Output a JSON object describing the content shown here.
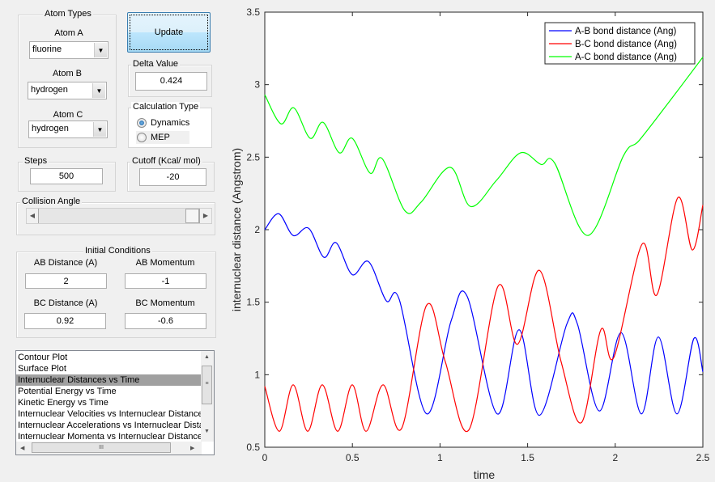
{
  "atom_types": {
    "title": "Atom Types",
    "atom_a_label": "Atom A",
    "atom_a": "fluorine",
    "atom_b_label": "Atom B",
    "atom_b": "hydrogen",
    "atom_c_label": "Atom C",
    "atom_c": "hydrogen"
  },
  "update_label": "Update",
  "delta": {
    "title": "Delta Value",
    "value": "0.424"
  },
  "calc_type": {
    "title": "Calculation Type",
    "options": [
      "Dynamics",
      "MEP"
    ],
    "selected": "Dynamics"
  },
  "steps": {
    "title": "Steps",
    "value": "500"
  },
  "cutoff": {
    "title": "Cutoff (Kcal/ mol)",
    "value": "-20"
  },
  "collision": {
    "title": "Collision Angle",
    "slider_fraction": 1.0
  },
  "initial": {
    "title": "Initial Conditions",
    "ab_dist_label": "AB Distance (A)",
    "ab_dist": "2",
    "ab_mom_label": "AB Momentum",
    "ab_mom": "-1",
    "bc_dist_label": "BC Distance (A)",
    "bc_dist": "0.92",
    "bc_mom_label": "BC Momentum",
    "bc_mom": "-0.6"
  },
  "plot_list": {
    "items": [
      "Contour Plot",
      "Surface Plot",
      "Internuclear Distances vs Time",
      "Potential Energy vs Time",
      "Kinetic Energy vs Time",
      "Internuclear Velocities vs Internuclear Distance",
      "Internuclear Accelerations vs Internuclear Distance",
      "Internuclear Momenta vs Internuclear Distance"
    ],
    "selected_index": 2
  },
  "chart_data": {
    "type": "line",
    "xlabel": "time",
    "ylabel": "internuclear distance (Angstrom)",
    "xlim": [
      0,
      2.5
    ],
    "ylim": [
      0.5,
      3.5
    ],
    "xticks": [
      "0",
      "0.5",
      "1",
      "1.5",
      "2",
      "2.5"
    ],
    "yticks": [
      "0.5",
      "1",
      "1.5",
      "2",
      "2.5",
      "3",
      "3.5"
    ],
    "legend_placement": "top-right",
    "grid": false,
    "series": [
      {
        "name": "A-B bond distance (Ang)",
        "color": "#0000ff",
        "points": [
          [
            0,
            2.0
          ],
          [
            0.079,
            2.11
          ],
          [
            0.162,
            1.96
          ],
          [
            0.25,
            2.01
          ],
          [
            0.337,
            1.81
          ],
          [
            0.407,
            1.91
          ],
          [
            0.499,
            1.69
          ],
          [
            0.592,
            1.78
          ],
          [
            0.693,
            1.51
          ],
          [
            0.767,
            1.52
          ],
          [
            0.924,
            0.73
          ],
          [
            1.063,
            1.37
          ],
          [
            1.155,
            1.54
          ],
          [
            1.326,
            0.73
          ],
          [
            1.451,
            1.31
          ],
          [
            1.567,
            0.72
          ],
          [
            1.724,
            1.35
          ],
          [
            1.784,
            1.35
          ],
          [
            1.909,
            0.75
          ],
          [
            2.033,
            1.29
          ],
          [
            2.149,
            0.73
          ],
          [
            2.246,
            1.26
          ],
          [
            2.352,
            0.73
          ],
          [
            2.449,
            1.25
          ],
          [
            2.5,
            1.02
          ]
        ]
      },
      {
        "name": "B-C bond distance (Ang)",
        "color": "#ff0000",
        "points": [
          [
            0,
            0.92
          ],
          [
            0.083,
            0.61
          ],
          [
            0.162,
            0.93
          ],
          [
            0.245,
            0.61
          ],
          [
            0.328,
            0.93
          ],
          [
            0.416,
            0.61
          ],
          [
            0.499,
            0.93
          ],
          [
            0.578,
            0.61
          ],
          [
            0.675,
            0.93
          ],
          [
            0.781,
            0.63
          ],
          [
            0.924,
            1.48
          ],
          [
            1.03,
            1.09
          ],
          [
            1.165,
            0.62
          ],
          [
            1.331,
            1.61
          ],
          [
            1.442,
            1.21
          ],
          [
            1.567,
            1.72
          ],
          [
            1.691,
            1.09
          ],
          [
            1.807,
            0.67
          ],
          [
            1.918,
            1.31
          ],
          [
            1.992,
            1.12
          ],
          [
            2.153,
            1.9
          ],
          [
            2.237,
            1.55
          ],
          [
            2.357,
            2.22
          ],
          [
            2.44,
            1.86
          ],
          [
            2.5,
            2.17
          ]
        ]
      },
      {
        "name": "A-C bond distance (Ang)",
        "color": "#00ff00",
        "points": [
          [
            0,
            2.93
          ],
          [
            0.092,
            2.73
          ],
          [
            0.166,
            2.84
          ],
          [
            0.259,
            2.63
          ],
          [
            0.333,
            2.74
          ],
          [
            0.425,
            2.53
          ],
          [
            0.499,
            2.63
          ],
          [
            0.601,
            2.39
          ],
          [
            0.67,
            2.49
          ],
          [
            0.8,
            2.13
          ],
          [
            0.892,
            2.19
          ],
          [
            1.058,
            2.43
          ],
          [
            1.174,
            2.16
          ],
          [
            1.322,
            2.34
          ],
          [
            1.46,
            2.53
          ],
          [
            1.576,
            2.45
          ],
          [
            1.654,
            2.46
          ],
          [
            1.844,
            1.96
          ],
          [
            2.047,
            2.51
          ],
          [
            2.14,
            2.62
          ],
          [
            2.338,
            2.93
          ],
          [
            2.5,
            3.19
          ]
        ]
      }
    ]
  }
}
